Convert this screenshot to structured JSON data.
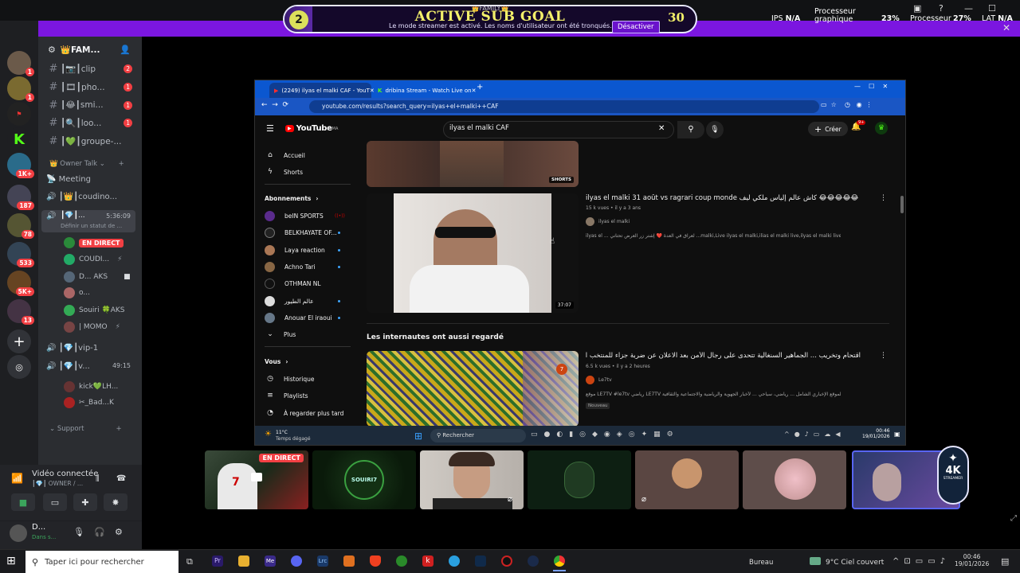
{
  "overlay": {
    "family_label": "👑FAMILY👑",
    "goal_title": "ACTIVE SUB GOAL",
    "goal_current": "2",
    "goal_target": "30",
    "goal_fill": 0.067,
    "streamer_message": "Le mode streamer est activé. Les noms d'utilisateur ont été tronqués.",
    "disable_button": "Désactiver",
    "ips_label": "IPS",
    "ips_value": "N/A",
    "gpu_label": "Processeur graphique",
    "gpu_value": "23%",
    "cpu_label": "Processeur",
    "cpu_value": "27%",
    "lat_label": "LAT",
    "lat_value": "N/A"
  },
  "guilds": [
    {
      "badge": ""
    },
    {
      "badge": "1"
    },
    {
      "badge": "1"
    },
    {
      "badge": ""
    },
    {
      "badge": ""
    },
    {
      "badge": "1K+"
    },
    {
      "badge": "187"
    },
    {
      "badge": "78"
    },
    {
      "badge": "533"
    },
    {
      "badge": "5K+"
    },
    {
      "badge": "13"
    }
  ],
  "server": {
    "name": "👑FAM...",
    "channels": [
      {
        "label": "┃📷┃clip",
        "count": "2"
      },
      {
        "label": "┃🎞┃pho...",
        "count": "1"
      },
      {
        "label": "┃😂┃smi...",
        "count": "1"
      },
      {
        "label": "┃🔍┃loo...",
        "count": "1"
      },
      {
        "label": "┃💚┃groupe-...",
        "count": ""
      }
    ],
    "category_owner": "Owner Talk",
    "meeting": "Meeting",
    "voice1": "┃👑┃coudino...",
    "voice2": "┃💎┃...",
    "voice2_time": "5:36:09",
    "status_text": "Définir un statut de ...",
    "live_label": "EN DIRECT",
    "members": [
      "COUDI...",
      "D...  AKS",
      "o...",
      "Souiri 🍀AKS",
      "| MOMO"
    ],
    "voice3": "┃💎┃vip-1",
    "voice4": "┃💎┃v...",
    "voice4_time": "49:15",
    "members2": [
      "kick💚LH...",
      "✂_Bad...K"
    ],
    "category_support": "Support"
  },
  "voice_panel": {
    "title": "Vidéo connectée",
    "sub": "┃💎┃ OWNER / ..."
  },
  "user_panel": {
    "name": "D...",
    "status": "Dans s..."
  },
  "browser": {
    "tab1": "(2249) ilyas el malki CAF - YouT",
    "tab2": "dribina Stream - Watch Live on",
    "url": "youtube.com/results?search_query=ilyas+el+malki++CAF",
    "search_query": "ilyas el malki  CAF",
    "create_label": "Créer",
    "notif_count": "9+",
    "youtube_label": "YouTube",
    "country_code": "MA"
  },
  "yt_sidebar": {
    "home": "Accueil",
    "shorts": "Shorts",
    "subs_header": "Abonnements",
    "subs": [
      "beIN SPORTS",
      "BELKHAYATE OF...",
      "Laya reaction",
      "Achno Tari",
      "OTHMAN NL",
      "عالم الطيور",
      "Anouar El iraoui"
    ],
    "more": "Plus",
    "you_header": "Vous",
    "history": "Historique",
    "playlists": "Playlists",
    "watch_later": "À regarder plus tard"
  },
  "yt_results": {
    "shorts_badge": "SHORTS",
    "video1_title": "ilyas el malki 31 août vs ragrari coup monde كاش عالم إلياس ملكي ليف 😂😂😂😂😂",
    "video1_meta": "15 k vues • il y a 3 ans",
    "video1_channel": "ilyas el malki",
    "video1_desc": "ilyas el ... لعراق في العدة ❤️ إشتر زر العرض تحتاني ...malki,Live ilyas el malki,ilias el malki live,ilyas el malki live,ilias el ...",
    "video1_duration": "37:07",
    "section_title": "Les internautes ont aussi regardé",
    "video2_title": "اقتحام وتخريب ... الجماهير السنغالية تتحدى على رجال الأمن بعد الاعلان عن ضربة جزاء للمنتخب المغربي",
    "video2_meta": "6.5 k vues • il y a 2 heures",
    "video2_channel": "Le7tv",
    "video2_desc": "موقع LE7TV #le7tv رياضي LE7TV الموقع الإخباري الشامل ... رياضي، سياحي ... لأخبار الجهوية والرياضية والاجتماعية والثقافية",
    "video2_badge": "Nouveau"
  },
  "inner_taskbar": {
    "weather_temp": "11°C",
    "weather_desc": "Temps dégagé",
    "search": "Rechercher",
    "time": "00:46",
    "date": "19/01/2026"
  },
  "cams": {
    "live_label": "EN DIRECT",
    "logo_text": "SOUIRI7",
    "brand_text": "4K",
    "brand_sub": "STREAMER"
  },
  "taskbar": {
    "search_placeholder": "Taper ici pour rechercher",
    "desktop_label": "Bureau",
    "weather": "9°C  Ciel couvert",
    "time": "00:46",
    "date": "19/01/2026"
  }
}
